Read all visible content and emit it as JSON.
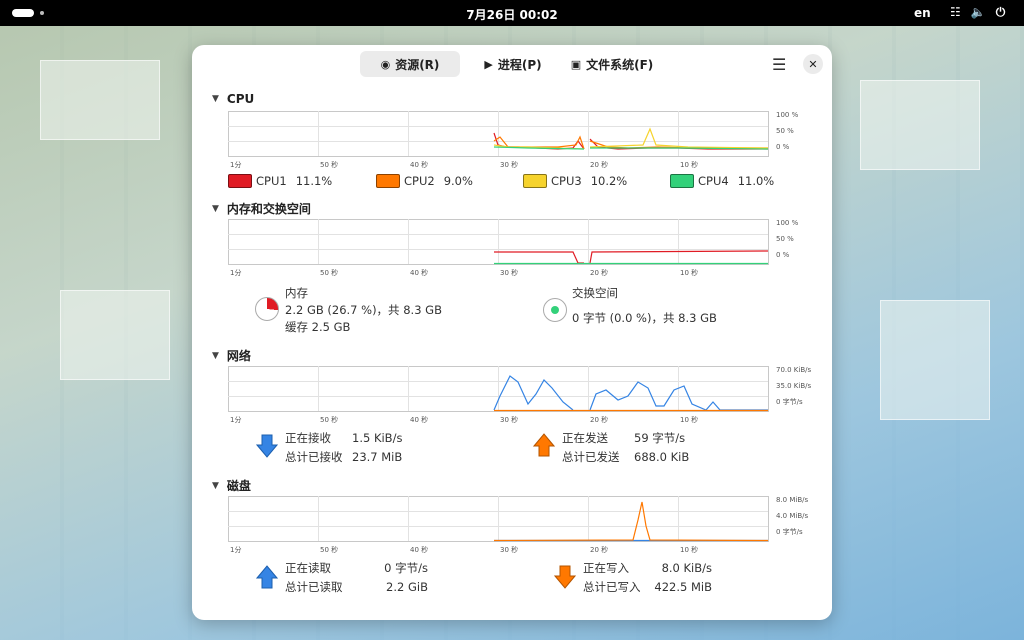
{
  "topbar": {
    "clock": "7月26日  00:02",
    "lang": "en"
  },
  "tabs": [
    {
      "label": "资源(R)",
      "icon": "gauge-icon"
    },
    {
      "label": "进程(P)",
      "icon": "play-icon"
    },
    {
      "label": "文件系统(F)",
      "icon": "disk-icon"
    }
  ],
  "time_ticks": [
    "1分",
    "50 秒",
    "40 秒",
    "30 秒",
    "20 秒",
    "10 秒"
  ],
  "cpu": {
    "title": "CPU",
    "y_ticks": [
      "100 %",
      "50 %",
      "0 %"
    ],
    "legend": [
      {
        "name": "CPU1",
        "value": "11.1%",
        "color": "#e01b24"
      },
      {
        "name": "CPU2",
        "value": "9.0%",
        "color": "#ff7800"
      },
      {
        "name": "CPU3",
        "value": "10.2%",
        "color": "#f6d32d"
      },
      {
        "name": "CPU4",
        "value": "11.0%",
        "color": "#33d17a"
      }
    ]
  },
  "memory": {
    "title": "内存和交换空间",
    "y_ticks": [
      "100 %",
      "50 %",
      "0 %"
    ],
    "mem_label": "内存",
    "mem_usage": "2.2 GB (26.7 %)，共 8.3 GB",
    "mem_cache": "缓存 2.5 GB",
    "swap_label": "交换空间",
    "swap_usage": "0 字节 (0.0 %)，共 8.3 GB",
    "mem_color": "#e01b24",
    "swap_color": "#33d17a"
  },
  "network": {
    "title": "网络",
    "y_ticks": [
      "70.0 KiB/s",
      "35.0 KiB/s",
      "0 字节/s"
    ],
    "recv_label": "正在接收",
    "recv_value": "1.5 KiB/s",
    "recv_total_label": "总计已接收",
    "recv_total_value": "23.7 MiB",
    "send_label": "正在发送",
    "send_value": "59 字节/s",
    "send_total_label": "总计已发送",
    "send_total_value": "688.0 KiB",
    "recv_color": "#3584e4",
    "send_color": "#ff7800"
  },
  "disk": {
    "title": "磁盘",
    "y_ticks": [
      "8.0 MiB/s",
      "4.0 MiB/s",
      "0 字节/s"
    ],
    "read_label": "正在读取",
    "read_value": "0 字节/s",
    "read_total_label": "总计已读取",
    "read_total_value": "2.2 GiB",
    "write_label": "正在写入",
    "write_value": "8.0 KiB/s",
    "write_total_label": "总计已写入",
    "write_total_value": "422.5 MiB",
    "read_color": "#3584e4",
    "write_color": "#ff7800"
  }
}
